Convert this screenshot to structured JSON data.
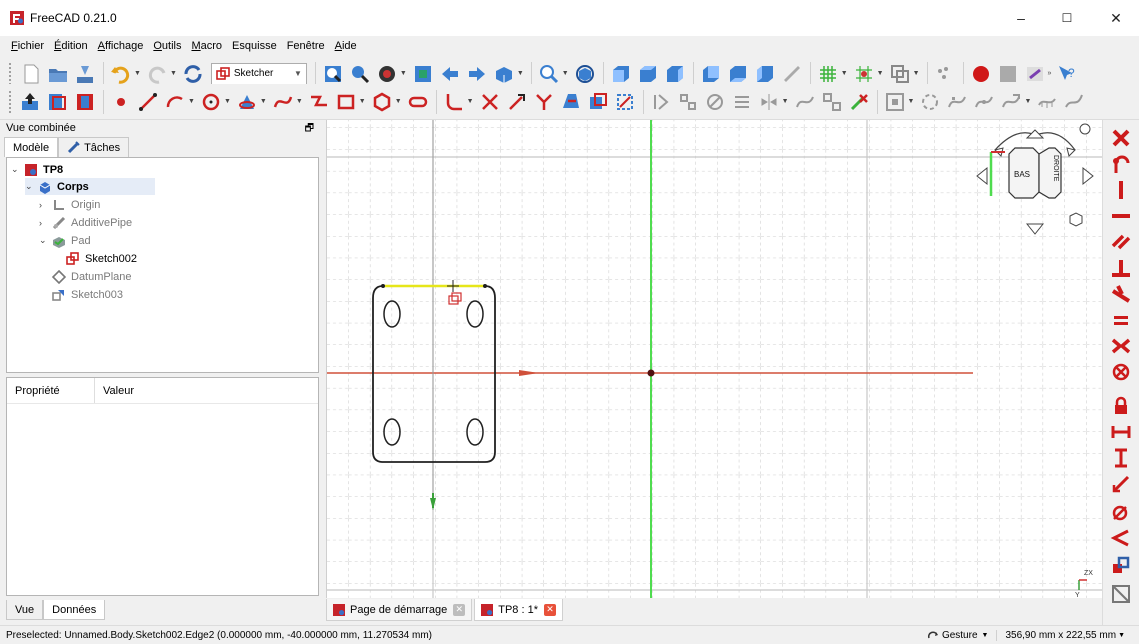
{
  "window": {
    "title": "FreeCAD 0.21.0",
    "controls": {
      "minimize": "–",
      "maximize": "☐",
      "close": "✕"
    }
  },
  "menubar": {
    "items": [
      {
        "label": "Fichier",
        "key": "F"
      },
      {
        "label": "Édition",
        "key": "É"
      },
      {
        "label": "Affichage",
        "key": "A"
      },
      {
        "label": "Outils",
        "key": "O"
      },
      {
        "label": "Macro",
        "key": "M"
      },
      {
        "label": "Esquisse",
        "key": ""
      },
      {
        "label": "Fenêtre",
        "key": ""
      },
      {
        "label": "Aide",
        "key": "A"
      }
    ]
  },
  "toolbar": {
    "workbench": "Sketcher"
  },
  "left_panel": {
    "title": "Vue combinée",
    "tabs": [
      "Modèle",
      "Tâches"
    ],
    "tree": [
      {
        "label": "TP8",
        "icon": "document-icon",
        "bold": true
      },
      {
        "label": "Corps",
        "icon": "body-icon",
        "bold": true
      },
      {
        "label": "Origin",
        "icon": "origin-icon"
      },
      {
        "label": "AdditivePipe",
        "icon": "additive-pipe-icon"
      },
      {
        "label": "Pad",
        "icon": "pad-icon"
      },
      {
        "label": "Sketch002",
        "icon": "sketch-icon"
      },
      {
        "label": "DatumPlane",
        "icon": "datum-plane-icon"
      },
      {
        "label": "Sketch003",
        "icon": "sketch-icon"
      }
    ],
    "properties_header": {
      "property": "Propriété",
      "value": "Valeur"
    },
    "bottom_tabs": [
      "Vue",
      "Données"
    ]
  },
  "navcube": {
    "faces": {
      "front": "BAS",
      "right": "DROITE"
    }
  },
  "doc_tabs": [
    {
      "label": "Page de démarrage"
    },
    {
      "label": "TP8 : 1*"
    }
  ],
  "statusbar": {
    "message": "Preselected: Unnamed.Body.Sketch002.Edge2 (0.000000 mm, -40.000000 mm, 11.270534 mm)",
    "navigation_style": "Gesture",
    "dimensions": "356,90 mm x 222,55 mm"
  },
  "colors": {
    "sketch_edge": "#202020",
    "preselect": "#e6e619",
    "x_axis": "#d0503a",
    "y_axis": "#4fdc4f",
    "constraint_red": "#cc1b1b"
  }
}
